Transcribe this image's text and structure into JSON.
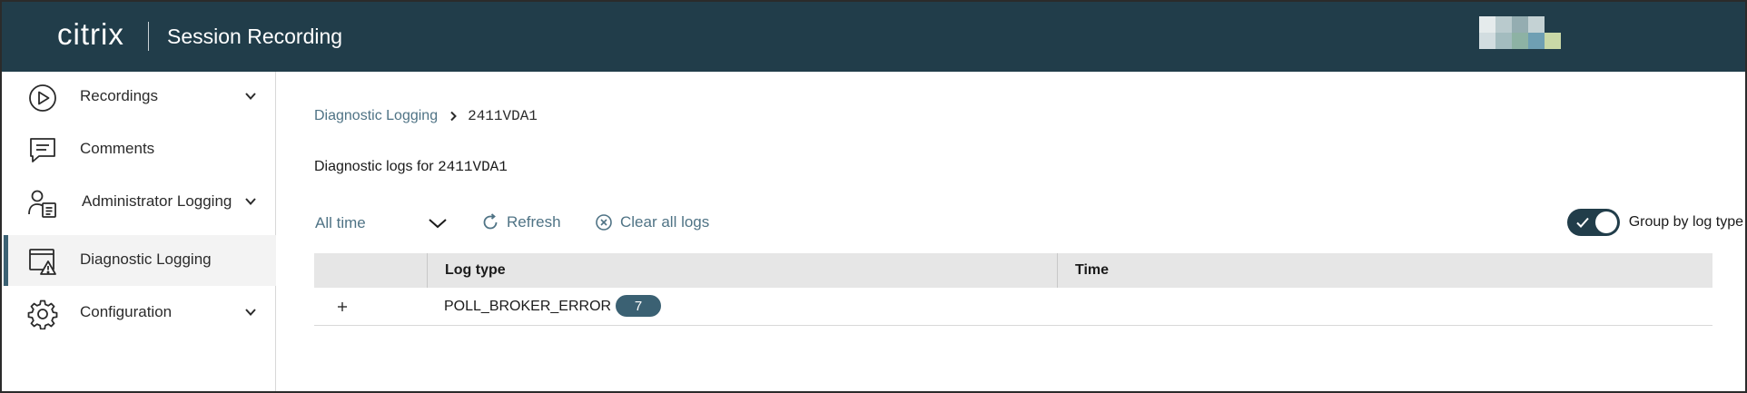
{
  "header": {
    "logo_text": "citrix",
    "app_title": "Session Recording",
    "avatar_colors": [
      "#e5ebec",
      "#b9cacd",
      "#94adb1",
      "#c4d2d4",
      "#213d4a",
      "#d2dde0",
      "#a3bcbf",
      "#8db2a4",
      "#6f9fb3",
      "#c9d8a7"
    ]
  },
  "sidebar": {
    "items": [
      {
        "label": "Recordings",
        "icon": "play-circle-icon",
        "has_chevron": true,
        "active": false
      },
      {
        "label": "Comments",
        "icon": "comment-icon",
        "has_chevron": false,
        "active": false
      },
      {
        "label": "Administrator Logging",
        "icon": "admin-log-icon",
        "has_chevron": true,
        "active": false
      },
      {
        "label": "Diagnostic Logging",
        "icon": "diagnostic-warning-icon",
        "has_chevron": false,
        "active": true
      },
      {
        "label": "Configuration",
        "icon": "gear-icon",
        "has_chevron": true,
        "active": false
      }
    ]
  },
  "main": {
    "breadcrumb": {
      "parent": "Diagnostic Logging",
      "current": "2411VDA1"
    },
    "heading_prefix": "Diagnostic logs for ",
    "heading_machine": "2411VDA1",
    "toolbar": {
      "time_filter": "All time",
      "refresh_label": "Refresh",
      "clear_label": "Clear all logs",
      "group_toggle_label": "Group by log type",
      "group_toggle_on": true
    },
    "table": {
      "columns": [
        "Log type",
        "Time"
      ],
      "rows": [
        {
          "log_type": "POLL_BROKER_ERROR",
          "count": "7",
          "time": ""
        }
      ]
    }
  },
  "colors": {
    "header_bg": "#213d4a",
    "link": "#4f7385",
    "badge": "#3b6173",
    "active_nav_bg": "#f3f3f3"
  }
}
